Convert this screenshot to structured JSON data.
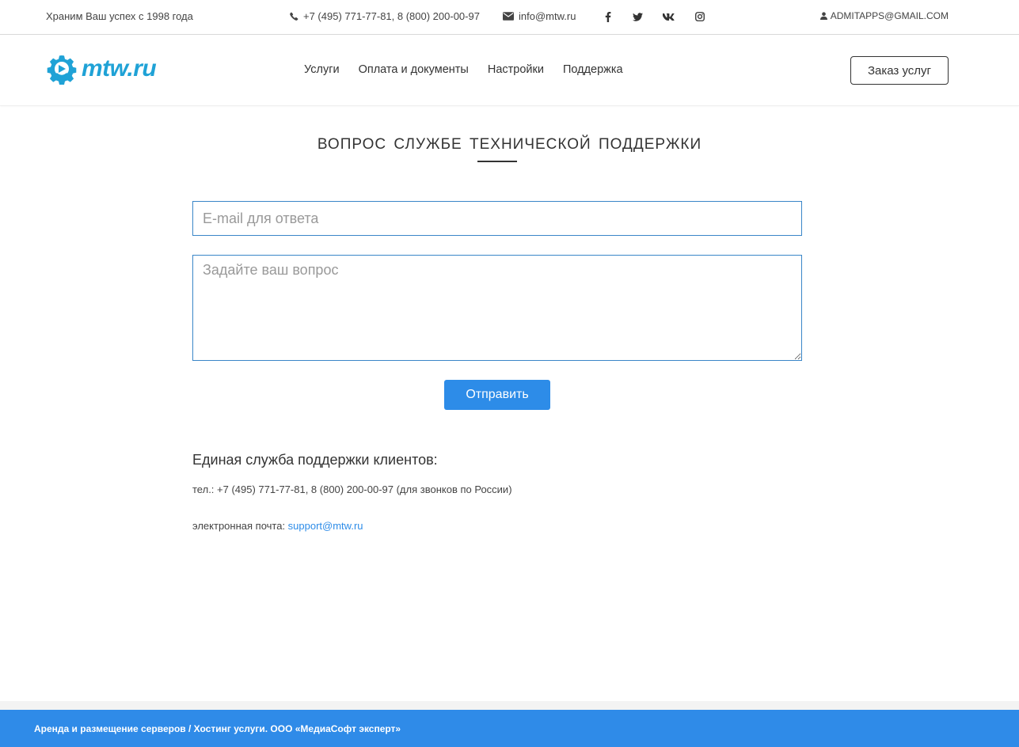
{
  "topbar": {
    "slogan": "Храним Ваш успех с 1998 года",
    "phones": "+7 (495) 771-77-81, 8 (800) 200-00-97",
    "email": "info@mtw.ru",
    "user": "ADMITAPPS@GMAIL.COM",
    "social_icons": [
      "facebook-icon",
      "twitter-icon",
      "vk-icon",
      "instagram-icon"
    ]
  },
  "header": {
    "logo_text": "mtw.ru",
    "nav": [
      "Услуги",
      "Оплата и документы",
      "Настройки",
      "Поддержка"
    ],
    "order_button": "Заказ услуг"
  },
  "main": {
    "title": "ВОПРОС СЛУЖБЕ ТЕХНИЧЕСКОЙ ПОДДЕРЖКИ",
    "email_placeholder": "E-mail для ответа",
    "email_value": "",
    "question_placeholder": "Задайте ваш вопрос",
    "question_value": "",
    "send_button": "Отправить"
  },
  "support": {
    "title": "Единая служба поддержки клиентов:",
    "phone_line": "тел.: +7 (495) 771-77-81, 8 (800) 200-00-97 (для звонков по России)",
    "mail_label": "электронная почта: ",
    "mail_link": "support@mtw.ru"
  },
  "footer": {
    "text": "Аренда и размещение серверов / Хостинг услуги. ООО «МедиаСофт эксперт»"
  },
  "colors": {
    "brand": "#1fa2d6",
    "accent": "#2d8ce8",
    "footer_bg": "#2f8be8",
    "input_border": "#3a86c8"
  }
}
